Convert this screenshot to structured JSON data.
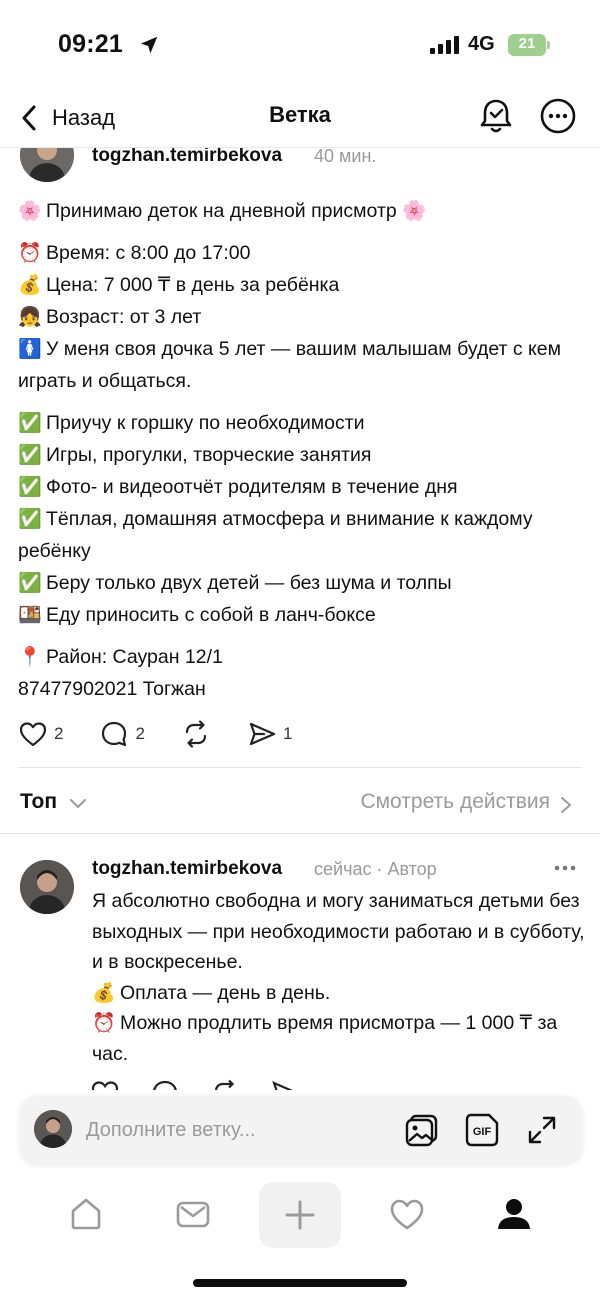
{
  "status_bar": {
    "time": "09:21",
    "network": "4G",
    "battery": "21"
  },
  "nav": {
    "back_label": "Назад",
    "title": "Ветка"
  },
  "post": {
    "username": "togzhan.temirbekova",
    "time": "40 мин.",
    "lines": [
      {
        "emoji": "🌸",
        "text": "Принимаю деток на дневной присмотр 🌸"
      },
      {
        "emoji": "⏰",
        "text": "Время: с 8:00 до 17:00"
      },
      {
        "emoji": "💰",
        "text": "Цена: 7 000 ₸ в день за ребёнка"
      },
      {
        "emoji": "👧",
        "text": "Возраст: от 3 лет"
      },
      {
        "emoji": "🚺",
        "text": "У меня своя дочка 5 лет — вашим малышам будет с кем играть и общаться."
      },
      {
        "emoji": "✅",
        "text": "Приучу к горшку по необходимости"
      },
      {
        "emoji": "✅",
        "text": "Игры, прогулки, творческие занятия"
      },
      {
        "emoji": "✅",
        "text": "Фото- и видеоотчёт родителям в течение дня"
      },
      {
        "emoji": "✅",
        "text": "Тёплая, домашняя атмосфера и внимание к каждому ребёнку"
      },
      {
        "emoji": "✅",
        "text": "Беру только двух детей — без шума и толпы"
      },
      {
        "emoji": "🍱",
        "text": "Еду приносить с собой в ланч-боксе"
      },
      {
        "emoji": "📍",
        "text": "Район: Сауран 12/1"
      },
      {
        "emoji": "",
        "text": "87477902021 Тогжан"
      }
    ],
    "likes": "2",
    "replies": "2",
    "shares": "1"
  },
  "sort": {
    "label": "Топ",
    "activity_link": "Смотреть действия"
  },
  "reply": {
    "username": "togzhan.temirbekova",
    "meta": "сейчас · Автор",
    "line1": "Я абсолютно свободна и могу заниматься детьми без выходных — при необходимости работаю и в субботу, и в воскресенье.",
    "line2_emoji": "💰",
    "line2": "Оплата — день в день.",
    "line3_emoji": "⏰",
    "line3": "Можно продлить время присмотра — 1 000 ₸ за час."
  },
  "composer": {
    "placeholder": "Дополните ветку..."
  },
  "icons": {
    "back": "chevron-left-icon",
    "follow": "bell-check-icon",
    "more": "ellipsis-circle-icon",
    "like": "heart-icon",
    "comment": "comment-icon",
    "repost": "repost-icon",
    "share": "send-icon",
    "gallery": "image-gallery-icon",
    "gif": "gif-icon",
    "expand": "expand-icon",
    "home": "home-icon",
    "inbox": "inbox-icon",
    "create": "plus-icon",
    "activity": "heart-icon",
    "profile": "profile-icon"
  },
  "colors": {
    "muted": "#9a9a9a",
    "text": "#101010",
    "battery": "#9fcf8c"
  }
}
